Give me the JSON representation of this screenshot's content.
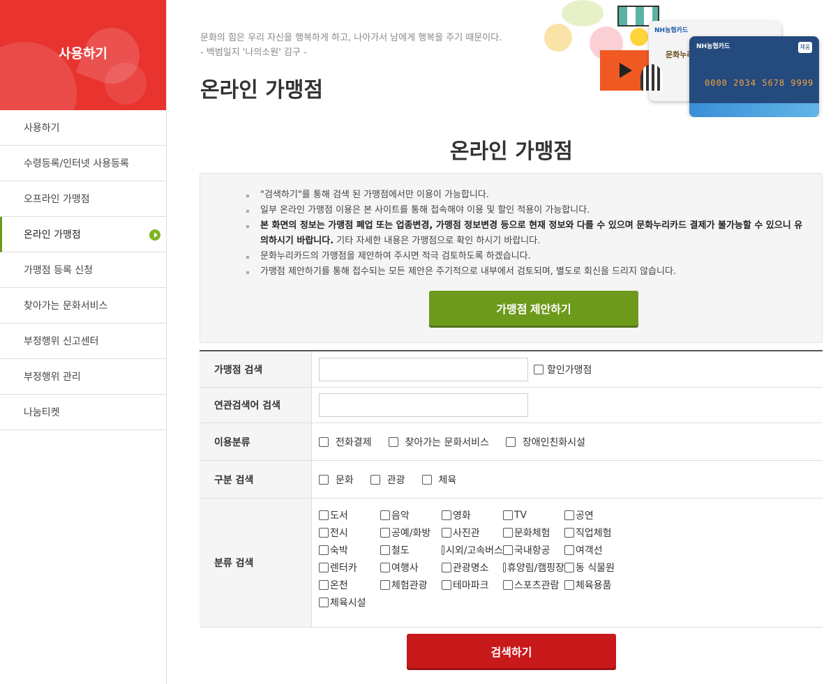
{
  "sidebar": {
    "title": "사용하기",
    "items": [
      {
        "label": "사용하기"
      },
      {
        "label": "수령등록/인터넷 사용등록"
      },
      {
        "label": "오프라인 가맹점"
      },
      {
        "label": "온라인 가맹점",
        "active": true
      },
      {
        "label": "가맹점 등록 신청"
      },
      {
        "label": "찾아가는 문화서비스"
      },
      {
        "label": "부정행위 신고센터"
      },
      {
        "label": "부정행위 관리"
      },
      {
        "label": "나눔티켓"
      }
    ]
  },
  "header": {
    "quote_line1": "문화의 힘은 우리 자신을 행복하게 하고, 나아가서 남에게 행복을 주기 때문이다.",
    "quote_line2": "- 백범일지 '나의소원' 김구 -",
    "page_title": "온라인 가맹점"
  },
  "banner": {
    "card_white_brand": "NH농협카드",
    "card_white_text": "문화누리",
    "card_blue_brand": "NH농협카드",
    "card_number": "0000 2034 5678 9999",
    "card_badge": "체움"
  },
  "content": {
    "title": "온라인 가맹점",
    "notices": [
      {
        "text": "\"검색하기\"를 통해 검색 된 가맹점에서만 이용이 가능합니다."
      },
      {
        "text": "일부 온라인 가맹점 이용은 본 사이트를 통해 접속해야 이용 및 할인 적용이 가능합니다."
      },
      {
        "bold": "본 화면의 정보는 가맹점 폐업 또는 업종변경, 가맹점 정보변경 등으로 현재 정보와 다를 수 있으며 문화누리카드 결제가 불가능할 수 있으니 유의하시기 바랍니다.",
        "text": " 기타 자세한 내용은 가맹점으로 확인 하시기 바랍니다."
      },
      {
        "text": "문화누리카드의 가맹점을 제안하여 주시면 적극 검토하도록 하겠습니다."
      },
      {
        "text": "가맹점 제안하기를 통해 접수되는 모든 제안은 주기적으로 내부에서 검토되며, 별도로 회신을 드리지 않습니다."
      }
    ],
    "suggest_button": "가맹점 제안하기"
  },
  "search": {
    "store_label": "가맹점 검색",
    "store_value": "",
    "discount_label": "할인가맹점",
    "related_label": "연관검색어 검색",
    "related_value": "",
    "usage_label": "이용분류",
    "usage_options": [
      "전화결제",
      "찾아가는 문화서비스",
      "장애인친화시설"
    ],
    "type_label": "구분 검색",
    "type_options": [
      "문화",
      "관광",
      "체육"
    ],
    "category_label": "분류 검색",
    "categories": [
      "도서",
      "음악",
      "영화",
      "TV",
      "공연",
      "전시",
      "공예/화방",
      "사진관",
      "문화체험",
      "직업체험",
      "숙박",
      "철도",
      "시외/고속버스",
      "국내항공",
      "여객선",
      "렌터카",
      "여행사",
      "관광명소",
      "휴양림/캠핑장",
      "동 식물원",
      "온천",
      "체험관광",
      "테마파크",
      "스포츠관람",
      "체육용품",
      "체육시설"
    ],
    "search_button": "검색하기"
  },
  "colors": {
    "brand_red": "#e8332f",
    "accent_green": "#6e9a1c",
    "search_red": "#c8191b"
  }
}
